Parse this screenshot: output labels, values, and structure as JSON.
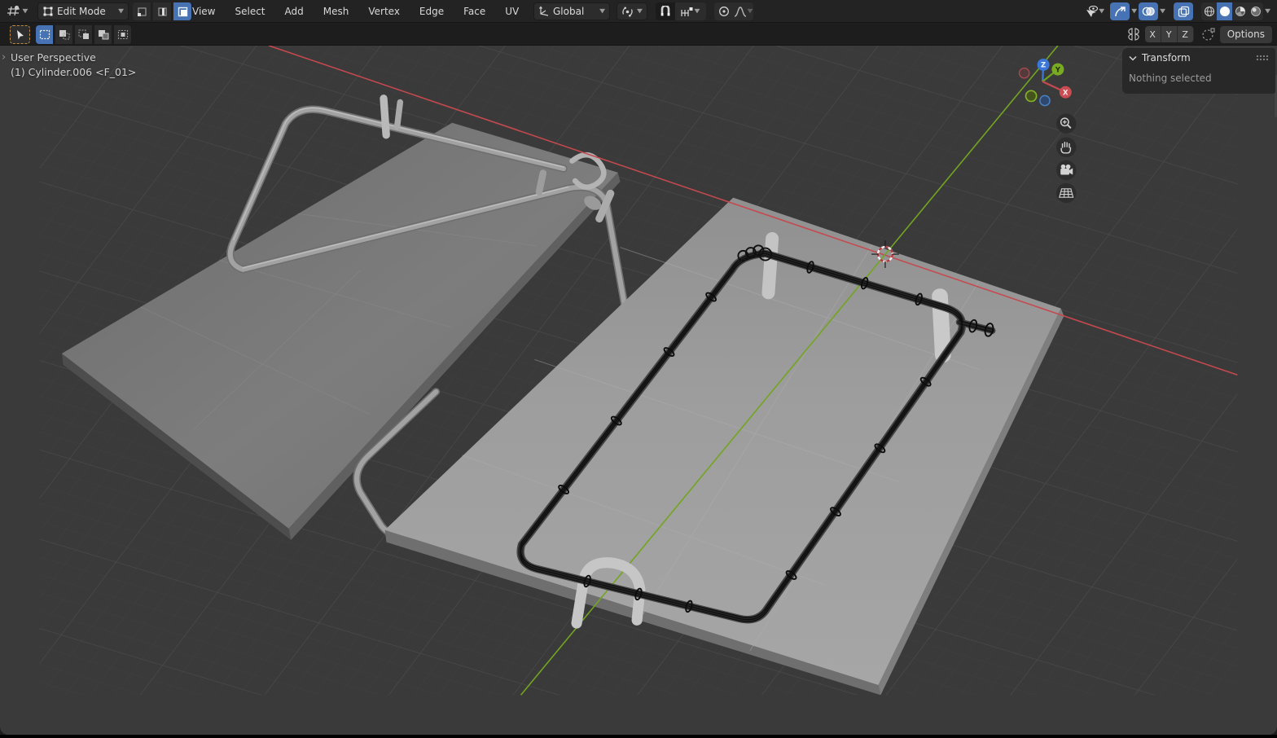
{
  "header": {
    "mode_label": "Edit Mode",
    "menus": [
      "View",
      "Select",
      "Add",
      "Mesh",
      "Vertex",
      "Edge",
      "Face",
      "UV"
    ],
    "orientation_label": "Global",
    "axis_toggles": [
      "X",
      "Y",
      "Z"
    ],
    "options_label": "Options"
  },
  "viewport": {
    "view_label": "User Perspective",
    "active_object_label": "(1) Cylinder.006 <F_01>",
    "expand_arrow": "›"
  },
  "sidebar": {
    "title": "Transform",
    "message": "Nothing selected"
  },
  "gizmo": {
    "x": "X",
    "y": "Y",
    "z": "Z"
  },
  "icons": {
    "editor_type": "viewport-grid-icon",
    "mode": "edit-cube-icon",
    "select_modes": [
      "vertex-select-icon",
      "edge-select-icon",
      "face-select-icon"
    ],
    "orientation": "axes-icon",
    "pivot": "pivot-orbit-icon",
    "snap": "magnet-icon",
    "snap_target": "snap-increment-icon",
    "proportional": "proportional-circle-icon",
    "falloff": "falloff-curve-icon",
    "visibility": "cursor-eye-icon",
    "gizmos": "gizmo-arrow-icon",
    "overlays": "overlays-circles-icon",
    "xray": "xray-squares-icon",
    "shading": [
      "wireframe-sphere-icon",
      "solid-sphere-icon",
      "material-sphere-icon",
      "rendered-sphere-icon"
    ],
    "tool": "tweak-cursor-icon",
    "mirror": "mirror-butterfly-icon",
    "snap_base": "snap-base-icon",
    "nav": [
      "zoom-icon",
      "pan-hand-icon",
      "camera-icon",
      "ortho-grid-icon"
    ]
  },
  "colors": {
    "accent_blue": "#4772b3",
    "axis_x_red": "#c4494e",
    "axis_y_green": "#6fa41f",
    "axis_z_blue": "#3b77d8",
    "tool_outline_orange": "#c08a3e",
    "viewport_bg": "#3a3a3a"
  }
}
